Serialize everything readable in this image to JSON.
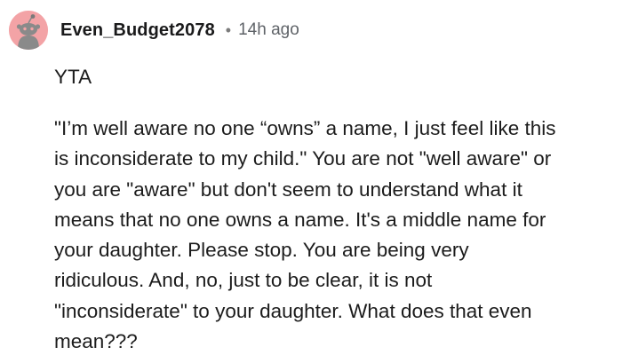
{
  "comment": {
    "username": "Even_Budget2078",
    "separator": "•",
    "timestamp": "14h ago",
    "avatar_icon": "reddit-snoo-avatar-icon",
    "avatar_color": "#f3a3a6",
    "verdict": "YTA",
    "body_lines": [
      "\"I’m well aware no one “owns” a name, I just feel like this",
      "is inconsiderate to my child.\" You are not \"well aware\" or",
      "you are \"aware\" but don't seem to understand what it",
      "means that no one owns a name. It's a middle name for",
      "your daughter. Please stop. You are being very",
      "ridiculous. And, no, just to be clear, it is not",
      "\"inconsiderate\" to your daughter. What does that even",
      "mean???"
    ]
  }
}
